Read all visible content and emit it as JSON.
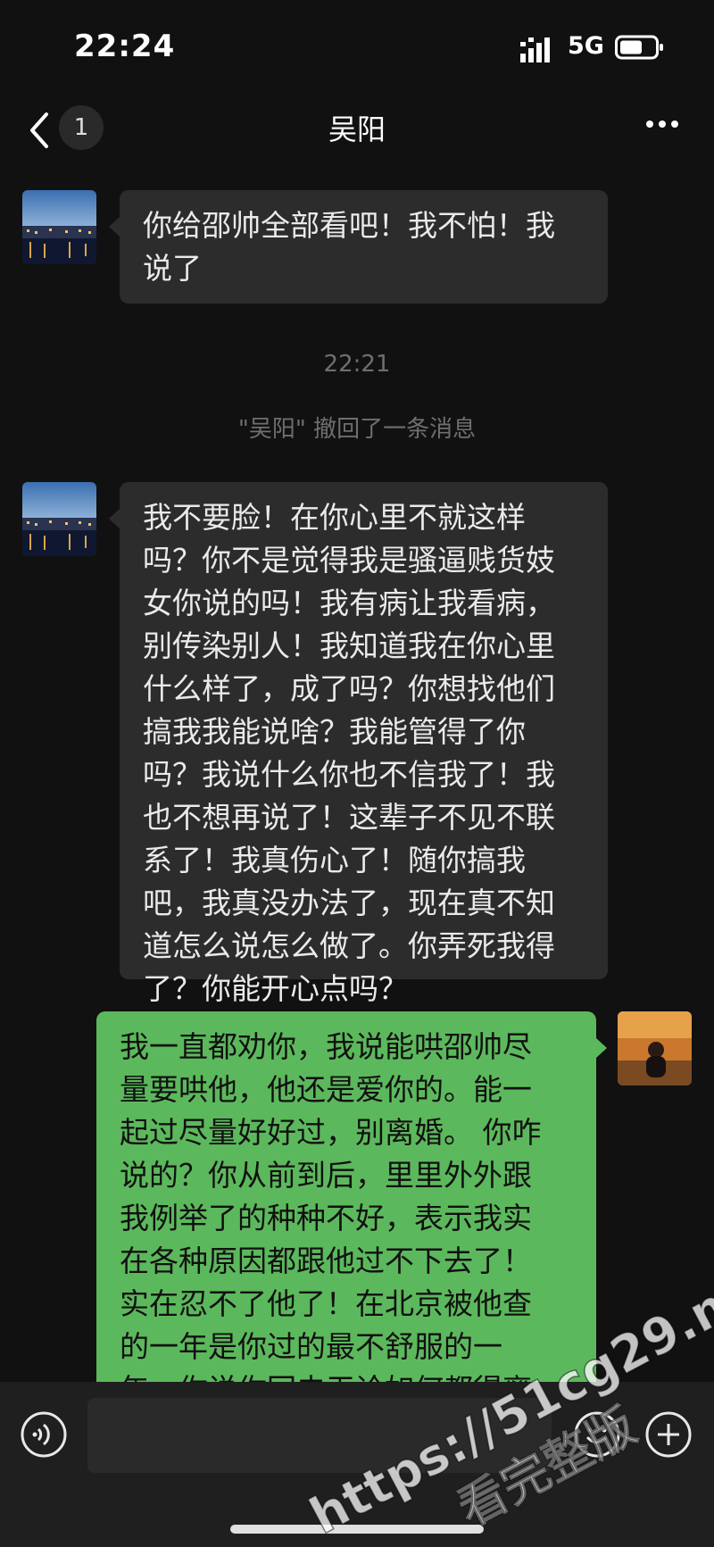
{
  "status_bar": {
    "time": "22:24",
    "network": "5G"
  },
  "header": {
    "unread_count": "1",
    "title": "吴阳"
  },
  "messages": [
    {
      "direction": "incoming",
      "text": "你给邵帅全部看吧！我不怕！我\n说了"
    },
    {
      "direction": "incoming",
      "text": "我不要脸！在你心里不就这样\n吗？你不是觉得我是骚逼贱货妓\n女你说的吗！我有病让我看病，\n别传染别人！我知道我在你心里\n什么样了，成了吗？你想找他们\n搞我我能说啥？我能管得了你\n吗？我说什么你也不信我了！我\n也不想再说了！这辈子不见不联\n系了！我真伤心了！随你搞我\n吧，我真没办法了，现在真不知\n道怎么说怎么做了。你弄死我得\n了？你能开心点吗？"
    },
    {
      "direction": "outgoing",
      "text": "我一直都劝你，我说能哄邵帅尽\n量要哄他，他还是爱你的。能一\n起过尽量好好过，别离婚。 你咋\n说的？你从前到后，里里外外跟\n我例举了的种种不好，表示我实\n在各种原因都跟他过不下去了！\n实在忍不了他了！在北京被他查\n的一年是你过的最不舒服的一\n年。你说你回去无论如何都得离"
    }
  ],
  "timestamp": "22:21",
  "recall_notice": "\"吴阳\" 撤回了一条消息",
  "input": {
    "placeholder": ""
  },
  "watermark": {
    "line1": "https://51cg29.me",
    "line2": "看完整版"
  },
  "colors": {
    "background": "#111111",
    "incoming_bubble": "#2c2c2c",
    "outgoing_bubble": "#5cb85c",
    "input_bar": "#1f1f1f"
  },
  "icons": [
    "back-arrow-icon",
    "more-icon",
    "voice-icon",
    "emoji-icon",
    "plus-icon",
    "signal-icon",
    "battery-icon"
  ]
}
